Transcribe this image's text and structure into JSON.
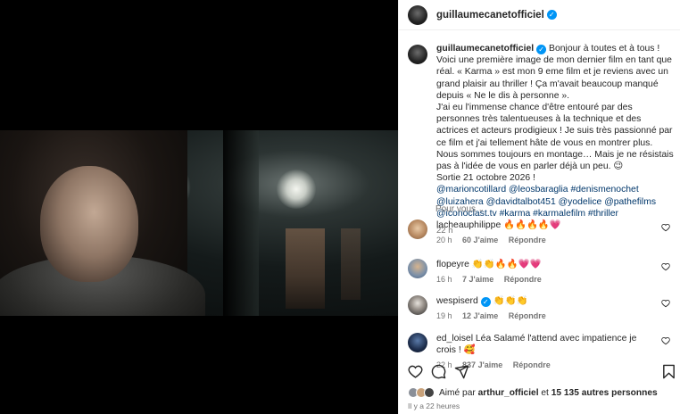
{
  "post": {
    "username": "guillaumecanetofficiel",
    "caption_lines": [
      "Bonjour à toutes et à tous ! Voici une première image de mon dernier film en tant que réal. « Karma » est mon 9 eme film et je reviens avec un grand plaisir au thriller ! Ça m'avait beaucoup manqué depuis « Ne le dis à personne ».",
      "J'ai eu l'immense chance d'être entouré par des personnes très talentueuses à la technique et des actrices et acteurs prodigieux ! Je suis très passionné par ce film et j'ai tellement hâte de vous en montrer plus. Nous sommes toujours en montage… Mais je ne résistais pas à l'idée de vous en parler déjà un peu. 😉",
      "Sortie 21 octobre 2026 !"
    ],
    "tags": "@marioncotillard @leosbaraglia #denismenochet @luizahera @davidtalbot451 @yodelice @pathefilms @iconoclast.tv #karma #karmalefilm #thriller",
    "time": "22 h",
    "sort_label": "Pour vous",
    "likes_prefix": "Aimé par",
    "likes_user": "arthur_officiel",
    "likes_mid": "et",
    "likes_count": "15 135 autres personnes",
    "posted_ago": "Il y a 22 heures"
  },
  "comments": [
    {
      "user": "lacheauphilippe",
      "verified": false,
      "text": "🔥🔥🔥🔥💗",
      "time": "20 h",
      "likes": "60 J'aime",
      "reply": "Répondre",
      "avatar_color": "#c9a27a"
    },
    {
      "user": "flopeyre",
      "verified": false,
      "text": "👏👏🔥🔥💗💗",
      "time": "16 h",
      "likes": "7 J'aime",
      "reply": "Répondre",
      "avatar_color": "#7a8fa8"
    },
    {
      "user": "wespiserd",
      "verified": true,
      "text": "👏👏👏",
      "time": "19 h",
      "likes": "12 J'aime",
      "reply": "Répondre",
      "avatar_color": "#3a3a3a"
    },
    {
      "user": "ed_loisel",
      "verified": false,
      "text": "Léa Salamé l'attend avec impatience je crois ! 🥰",
      "time": "22 h",
      "likes": "837 J'aime",
      "reply": "Répondre",
      "avatar_color": "#1c2c4a"
    }
  ],
  "colors": {
    "link": "#00376b",
    "verified": "#0095f6",
    "muted": "#737373"
  },
  "icons": {
    "like": "heart-icon",
    "comment": "comment-icon",
    "share": "share-icon",
    "save": "bookmark-icon"
  }
}
